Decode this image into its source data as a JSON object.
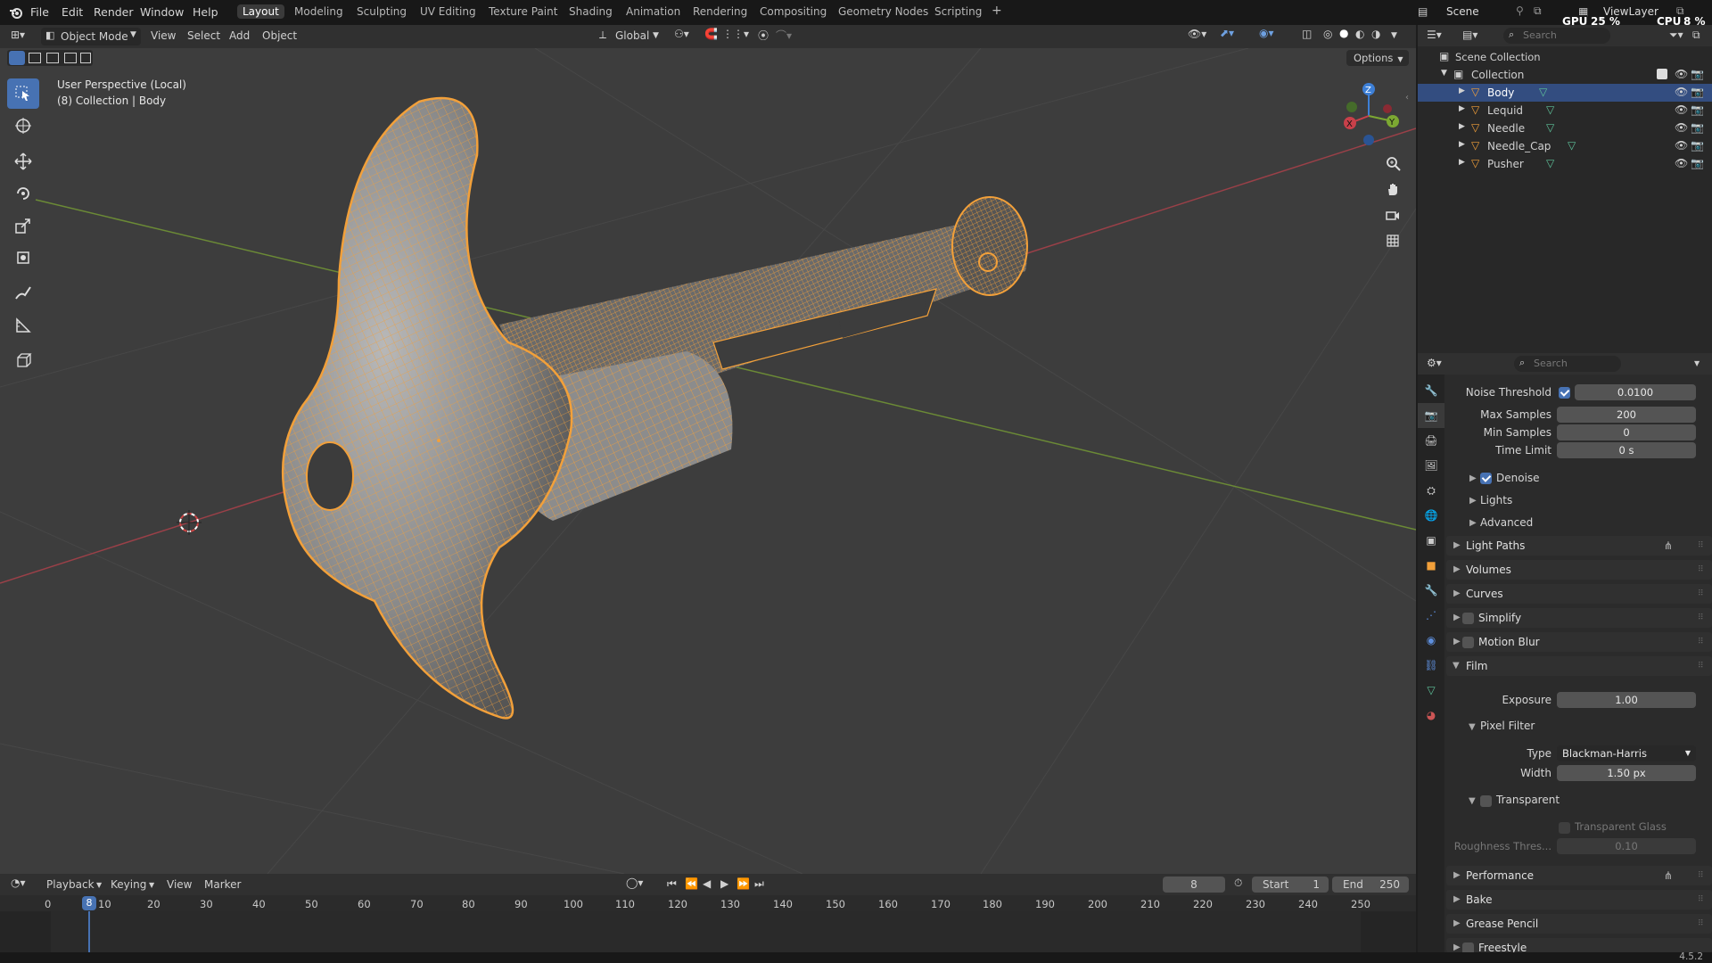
{
  "topbar": {
    "menus": [
      "File",
      "Edit",
      "Render",
      "Window",
      "Help"
    ],
    "workspaces": [
      "Layout",
      "Modeling",
      "Sculpting",
      "UV Editing",
      "Texture Paint",
      "Shading",
      "Animation",
      "Rendering",
      "Compositing",
      "Geometry Nodes",
      "Scripting"
    ],
    "active_workspace": "Layout",
    "add_tab": "+",
    "scene": "Scene",
    "view_layer": "ViewLayer",
    "gpu_label": "GPU",
    "gpu_value": "25 %",
    "cpu_label": "CPU",
    "cpu_value": "8 %"
  },
  "viewport_header": {
    "mode": "Object Mode",
    "menus": [
      "View",
      "Select",
      "Add",
      "Object"
    ],
    "transform_orientation": "Global",
    "options": "Options"
  },
  "viewport": {
    "perspective": "User Perspective (Local)",
    "collection_line": "(8) Collection | Body",
    "gizmo_axes": {
      "x": "X",
      "y": "Y",
      "z": "Z"
    },
    "colors": {
      "wire": "#f2a03a",
      "axis_x": "#c8404a",
      "axis_y": "#7ca832",
      "axis_z": "#3d7fd6",
      "selected": "#4772b3"
    }
  },
  "timeline": {
    "menus": [
      "Playback",
      "Keying",
      "View",
      "Marker"
    ],
    "current_frame": "8",
    "start_label": "Start",
    "start": "1",
    "end_label": "End",
    "end": "250",
    "ruler": [
      "0",
      "10",
      "20",
      "30",
      "40",
      "50",
      "60",
      "70",
      "80",
      "90",
      "100",
      "110",
      "120",
      "130",
      "140",
      "150",
      "160",
      "170",
      "180",
      "190",
      "200",
      "210",
      "220",
      "230",
      "240",
      "250"
    ],
    "playhead_label": "8"
  },
  "outliner": {
    "search_placeholder": "Search",
    "scene_collection": "Scene Collection",
    "collection": "Collection",
    "objects": [
      {
        "name": "Body",
        "selected": true
      },
      {
        "name": "Lequid",
        "selected": false
      },
      {
        "name": "Needle",
        "selected": false
      },
      {
        "name": "Needle_Cap",
        "selected": false
      },
      {
        "name": "Pusher",
        "selected": false
      }
    ]
  },
  "properties": {
    "search_placeholder": "Search",
    "noise_threshold_label": "Noise Threshold",
    "noise_threshold": "0.0100",
    "max_samples_label": "Max Samples",
    "max_samples": "200",
    "min_samples_label": "Min Samples",
    "min_samples": "0",
    "time_limit_label": "Time Limit",
    "time_limit": "0 s",
    "denoise": "Denoise",
    "lights": "Lights",
    "advanced": "Advanced",
    "light_paths": "Light Paths",
    "volumes": "Volumes",
    "curves": "Curves",
    "simplify": "Simplify",
    "motion_blur": "Motion Blur",
    "film": "Film",
    "exposure_label": "Exposure",
    "exposure": "1.00",
    "pixel_filter": "Pixel Filter",
    "type_label": "Type",
    "type": "Blackman-Harris",
    "width_label": "Width",
    "width": "1.50 px",
    "transparent": "Transparent",
    "transparent_glass": "Transparent Glass",
    "roughness_label": "Roughness Thres...",
    "roughness": "0.10",
    "performance": "Performance",
    "bake": "Bake",
    "grease_pencil": "Grease Pencil",
    "freestyle": "Freestyle"
  },
  "statusbar": {
    "version": "4.5.2"
  }
}
